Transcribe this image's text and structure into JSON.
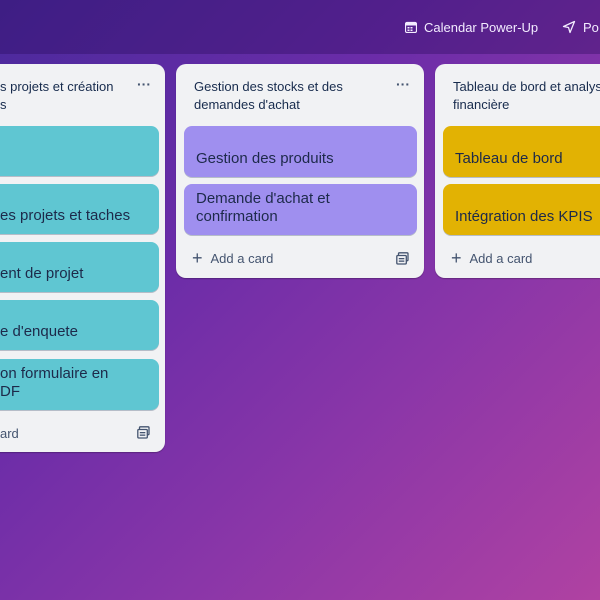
{
  "topbar": {
    "calendar_label": "Calendar Power-Up",
    "power_label": "Po"
  },
  "lists": [
    {
      "title": "s projets et création\ns",
      "cards": [
        {
          "text": ""
        },
        {
          "text": "es projets et taches"
        },
        {
          "text": "ent de projet"
        },
        {
          "text": "e d'enquete"
        },
        {
          "text": "on formulaire en\nDF"
        }
      ],
      "add_label": "ard",
      "card_color": "#5fc6d2"
    },
    {
      "title": "Gestion des stocks et des demandes d'achat",
      "cards": [
        {
          "text": "Gestion des produits"
        },
        {
          "text": "Demande d'achat et confirmation"
        }
      ],
      "add_label": "Add a card",
      "card_color": "#9f8fef"
    },
    {
      "title": "Tableau de bord et analyse\nfinancière",
      "cards": [
        {
          "text": "Tableau de bord"
        },
        {
          "text": "Intégration des KPIS"
        }
      ],
      "add_label": "Add a card",
      "card_color": "#e2b203"
    }
  ],
  "icons": {
    "calendar": "calendar-icon",
    "send": "send-icon",
    "menu": "more-horizontal-icon",
    "add": "plus-icon",
    "template": "template-icon"
  },
  "menu_glyph": "···",
  "add_glyph": "+"
}
